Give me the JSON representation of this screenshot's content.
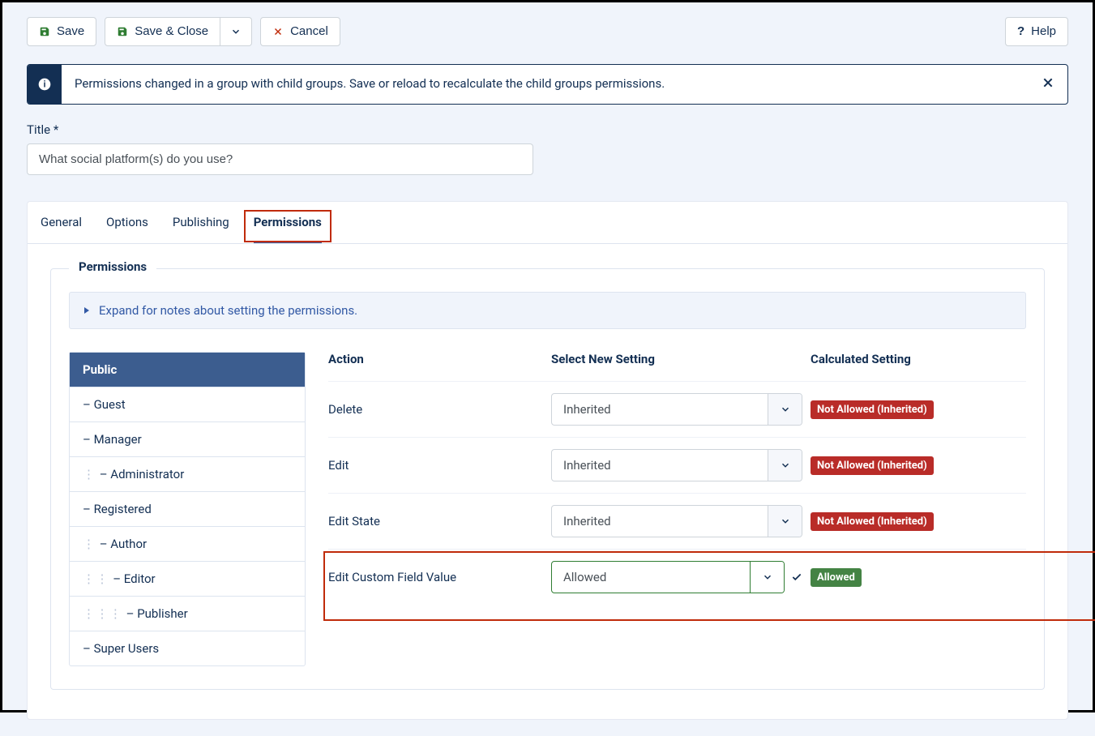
{
  "toolbar": {
    "save": "Save",
    "save_close": "Save & Close",
    "cancel": "Cancel",
    "help": "Help"
  },
  "alert": {
    "text": "Permissions changed in a group with child groups. Save or reload to recalculate the child groups permissions."
  },
  "title_field": {
    "label": "Title *",
    "value": "What social platform(s) do you use?"
  },
  "tabs": {
    "general": "General",
    "options": "Options",
    "publishing": "Publishing",
    "permissions": "Permissions"
  },
  "fieldset_legend": "Permissions",
  "expand_text": "Expand for notes about setting the permissions.",
  "groups": {
    "public": "Public",
    "guest": "– Guest",
    "manager": "– Manager",
    "administrator": "– Administrator",
    "registered": "– Registered",
    "author": "– Author",
    "editor": "– Editor",
    "publisher": "– Publisher",
    "super_users": "– Super Users"
  },
  "perm": {
    "head_action": "Action",
    "head_select": "Select New Setting",
    "head_calc": "Calculated Setting",
    "rows": {
      "delete": {
        "label": "Delete",
        "setting": "Inherited",
        "calc": "Not Allowed (Inherited)"
      },
      "edit": {
        "label": "Edit",
        "setting": "Inherited",
        "calc": "Not Allowed (Inherited)"
      },
      "edit_state": {
        "label": "Edit State",
        "setting": "Inherited",
        "calc": "Not Allowed (Inherited)"
      },
      "edit_cfv": {
        "label": "Edit Custom Field Value",
        "setting": "Allowed",
        "calc": "Allowed"
      }
    }
  }
}
